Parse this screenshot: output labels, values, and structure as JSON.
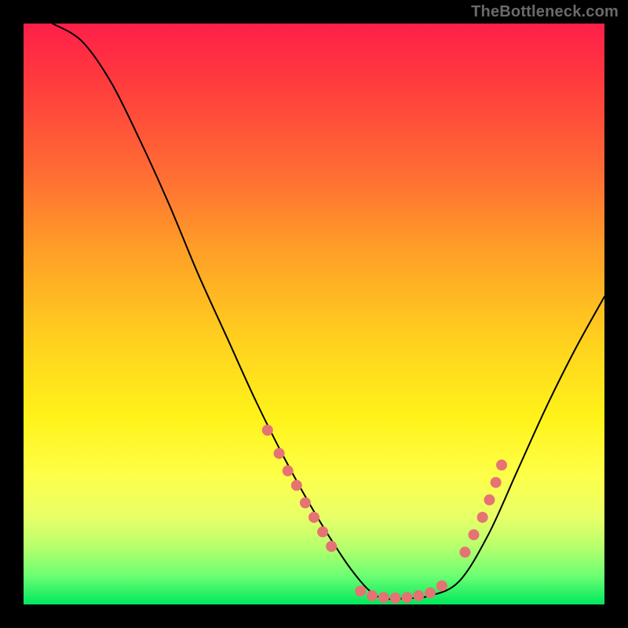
{
  "watermark": "TheBottleneck.com",
  "chart_data": {
    "type": "line",
    "title": "",
    "xlabel": "",
    "ylabel": "",
    "xlim": [
      0,
      100
    ],
    "ylim": [
      0,
      100
    ],
    "grid": false,
    "series": [
      {
        "name": "curve",
        "x": [
          5,
          10,
          15,
          20,
          25,
          30,
          35,
          40,
          45,
          50,
          55,
          58,
          60,
          62,
          65,
          70,
          75,
          80,
          85,
          90,
          95,
          100
        ],
        "y": [
          100,
          97,
          90,
          80,
          69,
          57,
          46,
          35,
          25,
          16,
          8,
          4,
          2,
          1,
          1,
          1.5,
          4,
          12,
          23,
          34,
          44,
          53
        ]
      }
    ],
    "markers": [
      {
        "x": 42,
        "y": 30
      },
      {
        "x": 44,
        "y": 26
      },
      {
        "x": 45.5,
        "y": 23
      },
      {
        "x": 47,
        "y": 20.5
      },
      {
        "x": 48.5,
        "y": 17.5
      },
      {
        "x": 50,
        "y": 15
      },
      {
        "x": 51.5,
        "y": 12.5
      },
      {
        "x": 53,
        "y": 10
      },
      {
        "x": 58,
        "y": 2.3
      },
      {
        "x": 60,
        "y": 1.5
      },
      {
        "x": 62,
        "y": 1.2
      },
      {
        "x": 64,
        "y": 1.1
      },
      {
        "x": 66,
        "y": 1.2
      },
      {
        "x": 68,
        "y": 1.5
      },
      {
        "x": 70,
        "y": 2.0
      },
      {
        "x": 72,
        "y": 3.2
      },
      {
        "x": 76,
        "y": 9
      },
      {
        "x": 77.5,
        "y": 12
      },
      {
        "x": 79,
        "y": 15
      },
      {
        "x": 80.2,
        "y": 18
      },
      {
        "x": 81.3,
        "y": 21
      },
      {
        "x": 82.3,
        "y": 24
      }
    ],
    "colors": {
      "curve": "#000000",
      "marker": "#e57373",
      "gradient_top": "#ff1f49",
      "gradient_bottom": "#00e85e"
    }
  }
}
